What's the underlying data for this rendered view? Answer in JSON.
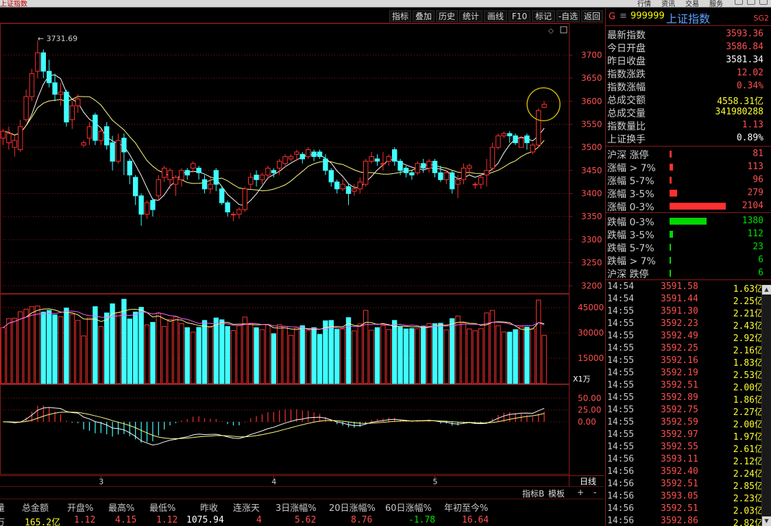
{
  "window": {
    "title": "上证指数",
    "top_buttons": [
      "行情",
      "资讯",
      "交易",
      "服务"
    ]
  },
  "toolbar": {
    "buttons": [
      "指标",
      "叠加",
      "历史",
      "统计",
      "画线",
      "F10",
      "标记",
      "-自选",
      "返回"
    ]
  },
  "chart": {
    "peak_label": "3731.69",
    "volume_unit": "X1万",
    "colors": {
      "up": "#ff3030",
      "down": "#40ffff",
      "ma5": "#ffffff",
      "ma10": "#ffff80",
      "highlight_circle": "#c8b400"
    },
    "chart_data": [
      {
        "type": "candlestick",
        "yticks": [
          3700,
          3650,
          3600,
          3550,
          3500,
          3450,
          3400,
          3350,
          3300,
          3250,
          3200
        ],
        "ylim": [
          3190,
          3760
        ],
        "xticks": [
          "3",
          "4",
          "5"
        ],
        "candles": [
          [
            3520,
            3535,
            3505,
            3540
          ],
          [
            3510,
            3530,
            3495,
            3545
          ],
          [
            3500,
            3515,
            3480,
            3525
          ],
          [
            3495,
            3545,
            3490,
            3560
          ],
          [
            3560,
            3610,
            3555,
            3625
          ],
          [
            3610,
            3660,
            3600,
            3670
          ],
          [
            3665,
            3705,
            3650,
            3731.69
          ],
          [
            3705,
            3665,
            3650,
            3712
          ],
          [
            3665,
            3640,
            3630,
            3690
          ],
          [
            3640,
            3615,
            3600,
            3660
          ],
          [
            3615,
            3620,
            3590,
            3640
          ],
          [
            3620,
            3555,
            3545,
            3625
          ],
          [
            3560,
            3590,
            3540,
            3600
          ],
          [
            3590,
            3605,
            3575,
            3615
          ],
          [
            3505,
            3510,
            3500,
            3515
          ],
          [
            3520,
            3545,
            3505,
            3555
          ],
          [
            3570,
            3515,
            3505,
            3575
          ],
          [
            3515,
            3535,
            3505,
            3540
          ],
          [
            3545,
            3505,
            3495,
            3555
          ],
          [
            3510,
            3470,
            3450,
            3525
          ],
          [
            3470,
            3515,
            3465,
            3530
          ],
          [
            3520,
            3490,
            3440,
            3530
          ],
          [
            3470,
            3440,
            3420,
            3475
          ],
          [
            3435,
            3395,
            3375,
            3440
          ],
          [
            3395,
            3355,
            3330,
            3400
          ],
          [
            3355,
            3380,
            3345,
            3385
          ],
          [
            3385,
            3365,
            3350,
            3390
          ],
          [
            3395,
            3430,
            3385,
            3440
          ],
          [
            3435,
            3455,
            3425,
            3460
          ],
          [
            3430,
            3450,
            3410,
            3455
          ],
          [
            3420,
            3435,
            3395,
            3440
          ],
          [
            3430,
            3450,
            3415,
            3455
          ],
          [
            3450,
            3440,
            3430,
            3455
          ],
          [
            3455,
            3465,
            3445,
            3470
          ],
          [
            3455,
            3445,
            3430,
            3460
          ],
          [
            3430,
            3410,
            3400,
            3440
          ],
          [
            3410,
            3420,
            3400,
            3435
          ],
          [
            3450,
            3420,
            3405,
            3455
          ],
          [
            3410,
            3380,
            3375,
            3415
          ],
          [
            3380,
            3360,
            3350,
            3385
          ],
          [
            3355,
            3355,
            3340,
            3360
          ],
          [
            3355,
            3365,
            3345,
            3370
          ],
          [
            3365,
            3410,
            3360,
            3415
          ],
          [
            3420,
            3435,
            3410,
            3445
          ],
          [
            3440,
            3430,
            3415,
            3450
          ],
          [
            3430,
            3440,
            3420,
            3445
          ],
          [
            3440,
            3455,
            3430,
            3460
          ],
          [
            3450,
            3445,
            3435,
            3455
          ],
          [
            3455,
            3470,
            3440,
            3475
          ],
          [
            3465,
            3480,
            3460,
            3485
          ],
          [
            3475,
            3480,
            3470,
            3485
          ],
          [
            3485,
            3490,
            3470,
            3495
          ],
          [
            3485,
            3475,
            3465,
            3490
          ],
          [
            3480,
            3495,
            3475,
            3500
          ],
          [
            3490,
            3480,
            3470,
            3495
          ],
          [
            3490,
            3480,
            3475,
            3495
          ],
          [
            3475,
            3450,
            3440,
            3485
          ],
          [
            3450,
            3425,
            3415,
            3455
          ],
          [
            3425,
            3410,
            3400,
            3430
          ],
          [
            3410,
            3420,
            3405,
            3430
          ],
          [
            3415,
            3400,
            3375,
            3420
          ],
          [
            3405,
            3410,
            3395,
            3420
          ],
          [
            3410,
            3425,
            3400,
            3435
          ],
          [
            3420,
            3470,
            3415,
            3475
          ],
          [
            3470,
            3480,
            3465,
            3490
          ],
          [
            3475,
            3470,
            3460,
            3485
          ],
          [
            3465,
            3465,
            3450,
            3490
          ],
          [
            3470,
            3480,
            3460,
            3485
          ],
          [
            3495,
            3470,
            3460,
            3500
          ],
          [
            3470,
            3450,
            3440,
            3475
          ],
          [
            3455,
            3445,
            3435,
            3460
          ],
          [
            3445,
            3440,
            3430,
            3450
          ],
          [
            3445,
            3465,
            3440,
            3470
          ],
          [
            3465,
            3455,
            3445,
            3475
          ],
          [
            3455,
            3470,
            3445,
            3475
          ],
          [
            3470,
            3445,
            3435,
            3475
          ],
          [
            3445,
            3430,
            3425,
            3460
          ],
          [
            3430,
            3445,
            3420,
            3450
          ],
          [
            3445,
            3410,
            3400,
            3450
          ],
          [
            3420,
            3430,
            3390,
            3440
          ],
          [
            3430,
            3455,
            3420,
            3465
          ],
          [
            3455,
            3460,
            3440,
            3465
          ],
          [
            3420,
            3420,
            3410,
            3425
          ],
          [
            3420,
            3435,
            3410,
            3440
          ],
          [
            3440,
            3450,
            3415,
            3475
          ],
          [
            3455,
            3500,
            3450,
            3510
          ],
          [
            3500,
            3525,
            3495,
            3530
          ],
          [
            3525,
            3530,
            3520,
            3535
          ],
          [
            3530,
            3525,
            3510,
            3535
          ],
          [
            3525,
            3510,
            3505,
            3530
          ],
          [
            3500,
            3520,
            3500,
            3525
          ],
          [
            3525,
            3510,
            3495,
            3530
          ],
          [
            3490,
            3505,
            3485,
            3510
          ],
          [
            3505,
            3580,
            3500,
            3585
          ],
          [
            3586.84,
            3593.36,
            3585,
            3600
          ]
        ]
      },
      {
        "type": "bar",
        "name": "volume",
        "yticks": [
          45000,
          30000,
          15000
        ],
        "ylim": [
          0,
          52000
        ]
      },
      {
        "type": "bar",
        "name": "macd",
        "yticks": [
          50.0,
          25.0,
          0.0
        ],
        "ylim": [
          -110,
          75
        ]
      }
    ]
  },
  "info": {
    "menu_icon": "≡",
    "g": "G",
    "code": "999999",
    "name": "上证指数",
    "tag": "SG2",
    "quote": [
      {
        "label": "最新指数",
        "value": "3593.36",
        "color": "red"
      },
      {
        "label": "今日开盘",
        "value": "3586.84",
        "color": "red"
      },
      {
        "label": "昨日收盘",
        "value": "3581.34",
        "color": "white"
      },
      {
        "label": "指数涨跌",
        "value": "12.02",
        "color": "red"
      },
      {
        "label": "指数涨幅",
        "value": "0.34%",
        "color": "red"
      },
      {
        "label": "总成交额",
        "value": "4558.31亿",
        "color": "yellow"
      },
      {
        "label": "总成交量",
        "value": "341980288",
        "color": "yellow"
      },
      {
        "label": "指数量比",
        "value": "1.13",
        "color": "red"
      },
      {
        "label": "上证换手",
        "value": "0.89%",
        "color": "white"
      }
    ],
    "breadth_up": [
      {
        "label": "沪深 涨停",
        "value": "81",
        "bar": 0.02
      },
      {
        "label": "涨幅 > 7%",
        "value": "113",
        "bar": 0.03
      },
      {
        "label": "涨幅 5-7%",
        "value": "96",
        "bar": 0.02
      },
      {
        "label": "涨幅 3-5%",
        "value": "279",
        "bar": 0.07
      },
      {
        "label": "涨幅 0-3%",
        "value": "2104",
        "bar": 0.51
      }
    ],
    "breadth_down": [
      {
        "label": "跌幅 0-3%",
        "value": "1380",
        "bar": 0.34
      },
      {
        "label": "跌幅 3-5%",
        "value": "112",
        "bar": 0.03
      },
      {
        "label": "跌幅 5-7%",
        "value": "23",
        "bar": 0.005
      },
      {
        "label": "跌幅 > 7%",
        "value": "6",
        "bar": 0.003
      },
      {
        "label": "沪深 跌停",
        "value": "6",
        "bar": 0.003
      }
    ],
    "ticks": [
      {
        "time": "14:54",
        "price": "3591.58",
        "amount": "1.63亿"
      },
      {
        "time": "14:54",
        "price": "3591.44",
        "amount": "2.25亿"
      },
      {
        "time": "14:55",
        "price": "3591.30",
        "amount": "2.21亿"
      },
      {
        "time": "14:55",
        "price": "3592.23",
        "amount": "2.43亿"
      },
      {
        "time": "14:55",
        "price": "3592.49",
        "amount": "2.92亿"
      },
      {
        "time": "14:55",
        "price": "3592.25",
        "amount": "2.16亿"
      },
      {
        "time": "14:55",
        "price": "3592.16",
        "amount": "1.83亿"
      },
      {
        "time": "14:55",
        "price": "3592.19",
        "amount": "2.53亿"
      },
      {
        "time": "14:55",
        "price": "3592.51",
        "amount": "2.00亿"
      },
      {
        "time": "14:55",
        "price": "3592.89",
        "amount": "1.86亿"
      },
      {
        "time": "14:55",
        "price": "3592.75",
        "amount": "2.27亿"
      },
      {
        "time": "14:55",
        "price": "3592.59",
        "amount": "2.00亿"
      },
      {
        "time": "14:55",
        "price": "3592.97",
        "amount": "1.97亿"
      },
      {
        "time": "14:55",
        "price": "3592.55",
        "amount": "2.61亿"
      },
      {
        "time": "14:56",
        "price": "3593.11",
        "amount": "2.12亿"
      },
      {
        "time": "14:56",
        "price": "3592.40",
        "amount": "2.24亿"
      },
      {
        "time": "14:56",
        "price": "3592.51",
        "amount": "2.85亿"
      },
      {
        "time": "14:56",
        "price": "3593.05",
        "amount": "2.23亿"
      },
      {
        "time": "14:56",
        "price": "3592.51",
        "amount": "2.03亿"
      },
      {
        "time": "14:56",
        "price": "3592.86",
        "amount": "2.82亿"
      }
    ]
  },
  "bottom": {
    "period_label": "日线",
    "tabs": [
      "指标B",
      "模板",
      "+",
      "-"
    ],
    "stats_headers": [
      "量",
      "总金额",
      "开盘%",
      "最高%",
      "最低%",
      "昨收",
      "连涨天",
      "3日涨幅%",
      "20日涨幅%",
      "60日涨幅%",
      "年初至今%"
    ],
    "stats_values": [
      "万",
      "165.2亿",
      "1.12",
      "4.15",
      "1.12",
      "1075.94",
      "4",
      "5.62",
      "8.76",
      "-1.78",
      "16.64"
    ],
    "stats_colors": [
      "#c8c8c8",
      "#ffff30",
      "#ff5050",
      "#ff5050",
      "#ff5050",
      "#ffffff",
      "#ff5050",
      "#ff5050",
      "#ff5050",
      "#00e000",
      "#ff5050"
    ]
  }
}
